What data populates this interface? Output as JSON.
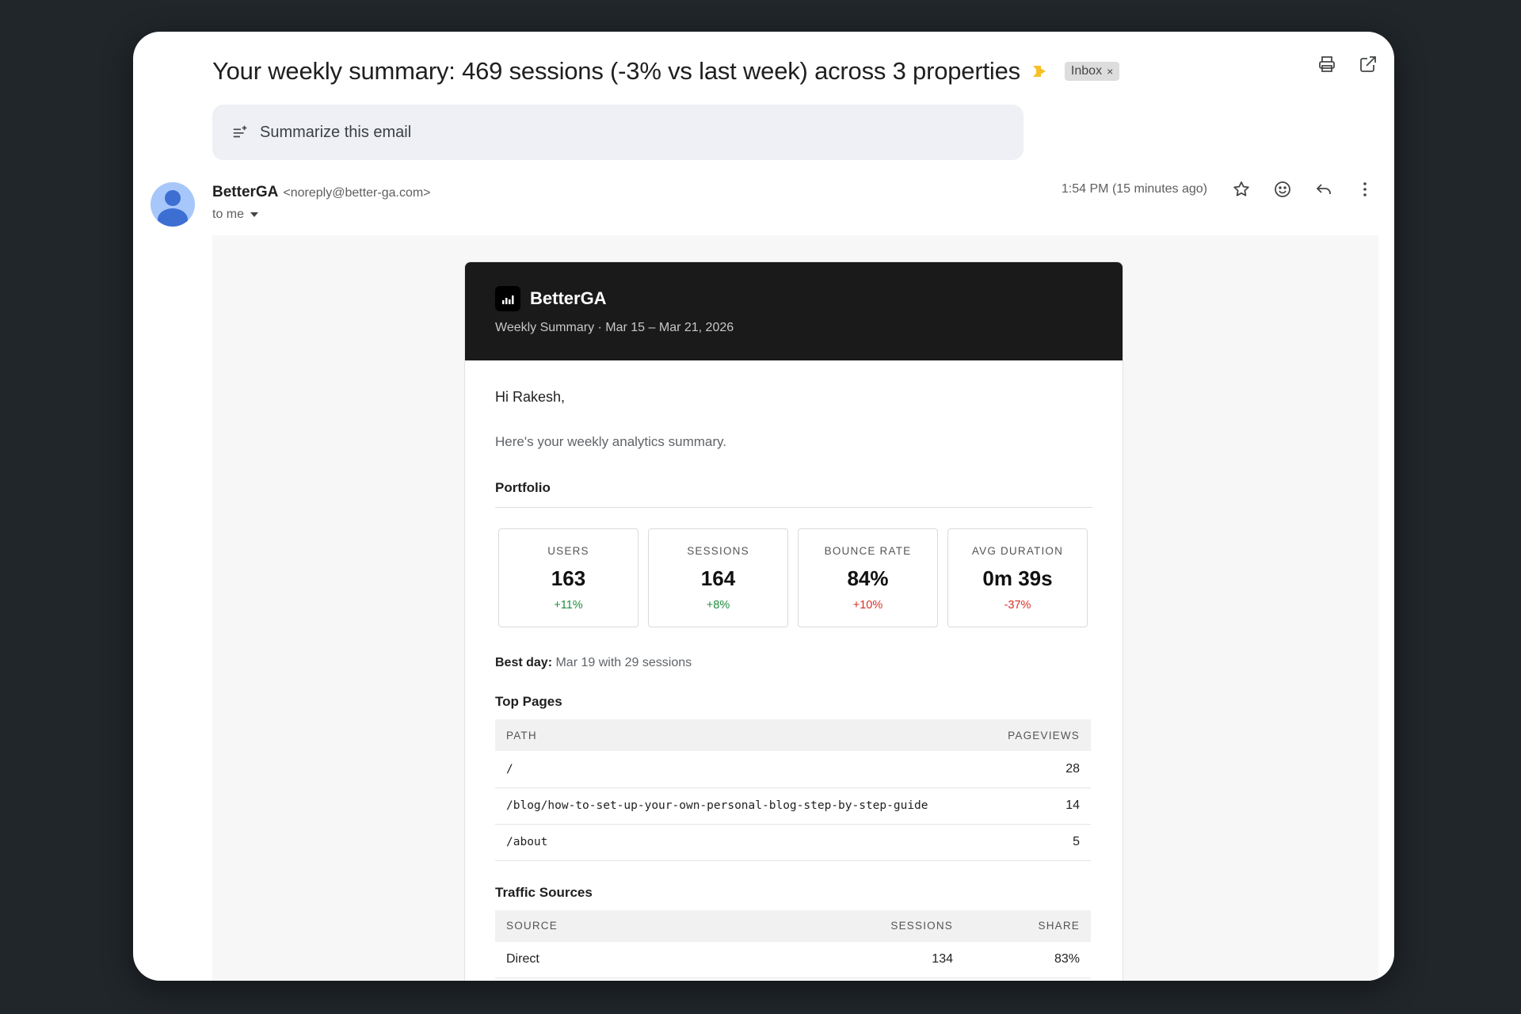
{
  "email": {
    "subject": "Your weekly summary: 469 sessions (-3% vs last week) across 3 properties",
    "label": "Inbox",
    "label_remove": "×",
    "summarize_label": "Summarize this email",
    "sender_name": "BetterGA",
    "sender_email": "<noreply@better-ga.com>",
    "to_label": "to me",
    "timestamp": "1:54 PM (15 minutes ago)",
    "icons": [
      "print-icon",
      "open-in-new-window-icon",
      "star-icon",
      "emoji-icon",
      "reply-icon",
      "more-vert-icon",
      "summarize-icon"
    ]
  },
  "body": {
    "brand": "BetterGA",
    "subtitle": "Weekly Summary · Mar 15 – Mar 21, 2026",
    "greeting": "Hi Rakesh,",
    "intro": "Here's your weekly analytics summary.",
    "portfolio_title": "Portfolio",
    "kpis": [
      {
        "label": "USERS",
        "value": "163",
        "delta": "+11%",
        "trend": "positive"
      },
      {
        "label": "SESSIONS",
        "value": "164",
        "delta": "+8%",
        "trend": "positive"
      },
      {
        "label": "BOUNCE RATE",
        "value": "84%",
        "delta": "+10%",
        "trend": "negative"
      },
      {
        "label": "AVG DURATION",
        "value": "0m 39s",
        "delta": "-37%",
        "trend": "negative"
      }
    ],
    "best_day_label": "Best day:",
    "best_day_text": " Mar 19 with 29 sessions",
    "top_pages_title": "Top Pages",
    "top_pages": {
      "headers": [
        "PATH",
        "PAGEVIEWS"
      ],
      "rows": [
        [
          "/",
          "28"
        ],
        [
          "/blog/how-to-set-up-your-own-personal-blog-step-by-step-guide",
          "14"
        ],
        [
          "/about",
          "5"
        ]
      ]
    },
    "traffic_title": "Traffic Sources",
    "traffic": {
      "headers": [
        "SOURCE",
        "SESSIONS",
        "SHARE"
      ],
      "rows": [
        [
          "Direct",
          "134",
          "83%"
        ]
      ]
    }
  },
  "colors": {
    "positive": "#1e8e3e",
    "negative": "#d93025",
    "important": "#f6c026",
    "header_bg": "#1a1a1a"
  }
}
